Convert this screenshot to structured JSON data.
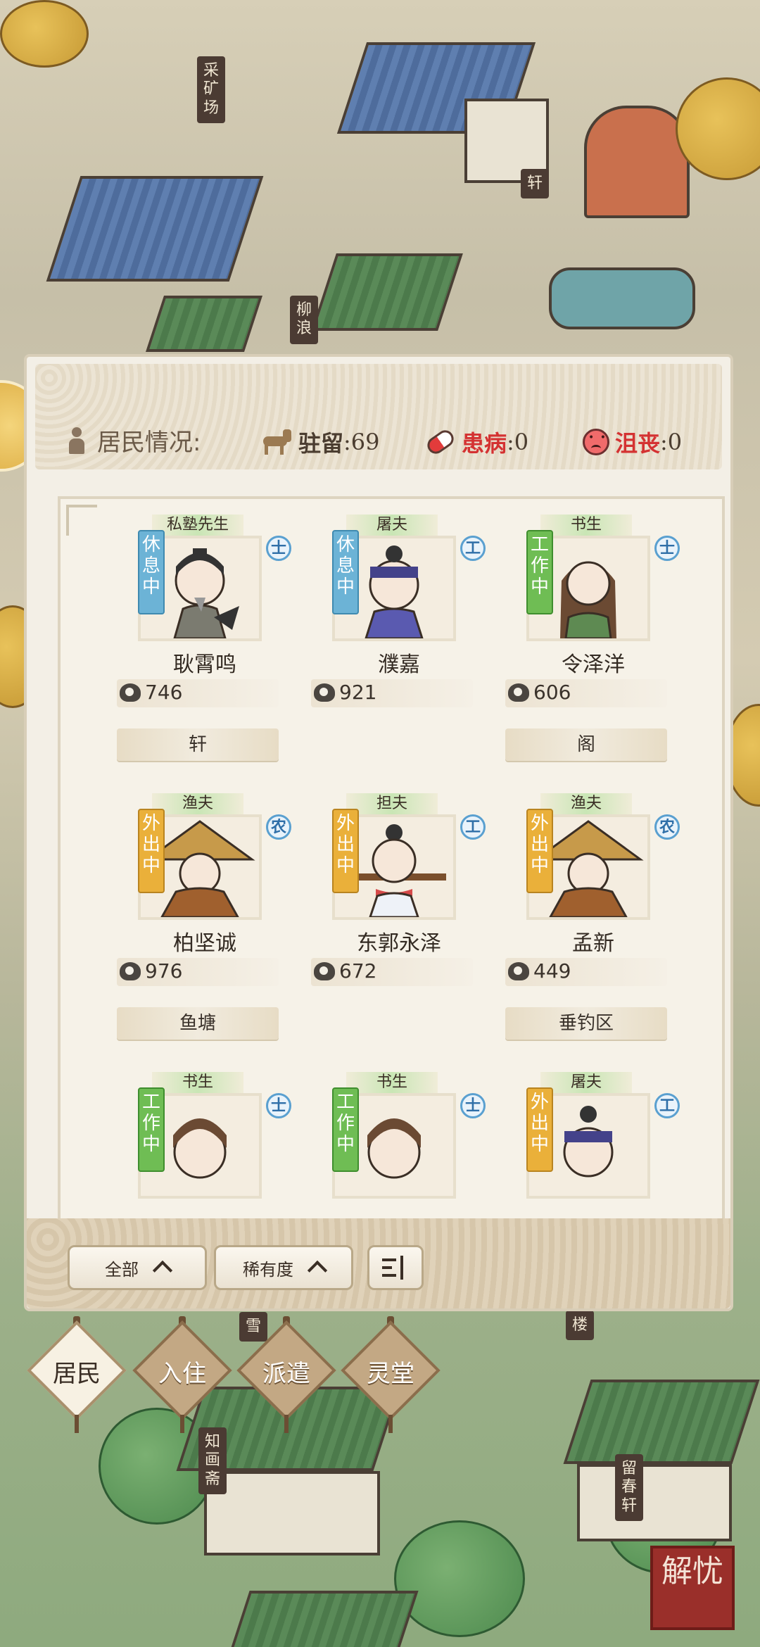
{
  "town_signs": [
    "采矿场",
    "轩",
    "柳浪",
    "知画斋",
    "留春轩",
    "楼",
    "雪"
  ],
  "header": {
    "residents_label": "居民情况:",
    "stay": {
      "label": "驻留",
      "value": ":69"
    },
    "sick": {
      "label": "患病",
      "value": ":0"
    },
    "sad": {
      "label": "沮丧",
      "value": ":0"
    }
  },
  "residents": [
    {
      "job": "私塾先生",
      "status": "休息中",
      "status_type": "rest",
      "class": "士",
      "name": "耿霄鸣",
      "hp": "746",
      "place": "轩"
    },
    {
      "job": "屠夫",
      "status": "休息中",
      "status_type": "rest",
      "class": "工",
      "name": "濮嘉",
      "hp": "921",
      "place": ""
    },
    {
      "job": "书生",
      "status": "工作中",
      "status_type": "work",
      "class": "士",
      "name": "令泽洋",
      "hp": "606",
      "place": "阁"
    },
    {
      "job": "渔夫",
      "status": "外出中",
      "status_type": "out",
      "class": "农",
      "name": "柏坚诚",
      "hp": "976",
      "place": "鱼塘"
    },
    {
      "job": "担夫",
      "status": "外出中",
      "status_type": "out",
      "class": "工",
      "name": "东郭永泽",
      "hp": "672",
      "place": ""
    },
    {
      "job": "渔夫",
      "status": "外出中",
      "status_type": "out",
      "class": "农",
      "name": "孟新",
      "hp": "449",
      "place": "垂钓区"
    },
    {
      "job": "书生",
      "status": "工作中",
      "status_type": "work",
      "class": "士",
      "name": "",
      "hp": "",
      "place": ""
    },
    {
      "job": "书生",
      "status": "工作中",
      "status_type": "work",
      "class": "士",
      "name": "",
      "hp": "",
      "place": ""
    },
    {
      "job": "屠夫",
      "status": "外出中",
      "status_type": "out",
      "class": "工",
      "name": "",
      "hp": "",
      "place": ""
    }
  ],
  "controls": {
    "filter_all": "全部",
    "filter_rarity": "稀有度"
  },
  "tabs": [
    "居民",
    "入住",
    "派遣",
    "灵堂"
  ],
  "seal": "解忧",
  "icons": {
    "stay": "horse-icon",
    "sick": "pill-icon",
    "sad": "sad-face-icon",
    "hp": "heart-icon",
    "residents": "person-icon",
    "filter": "filter-icon"
  }
}
